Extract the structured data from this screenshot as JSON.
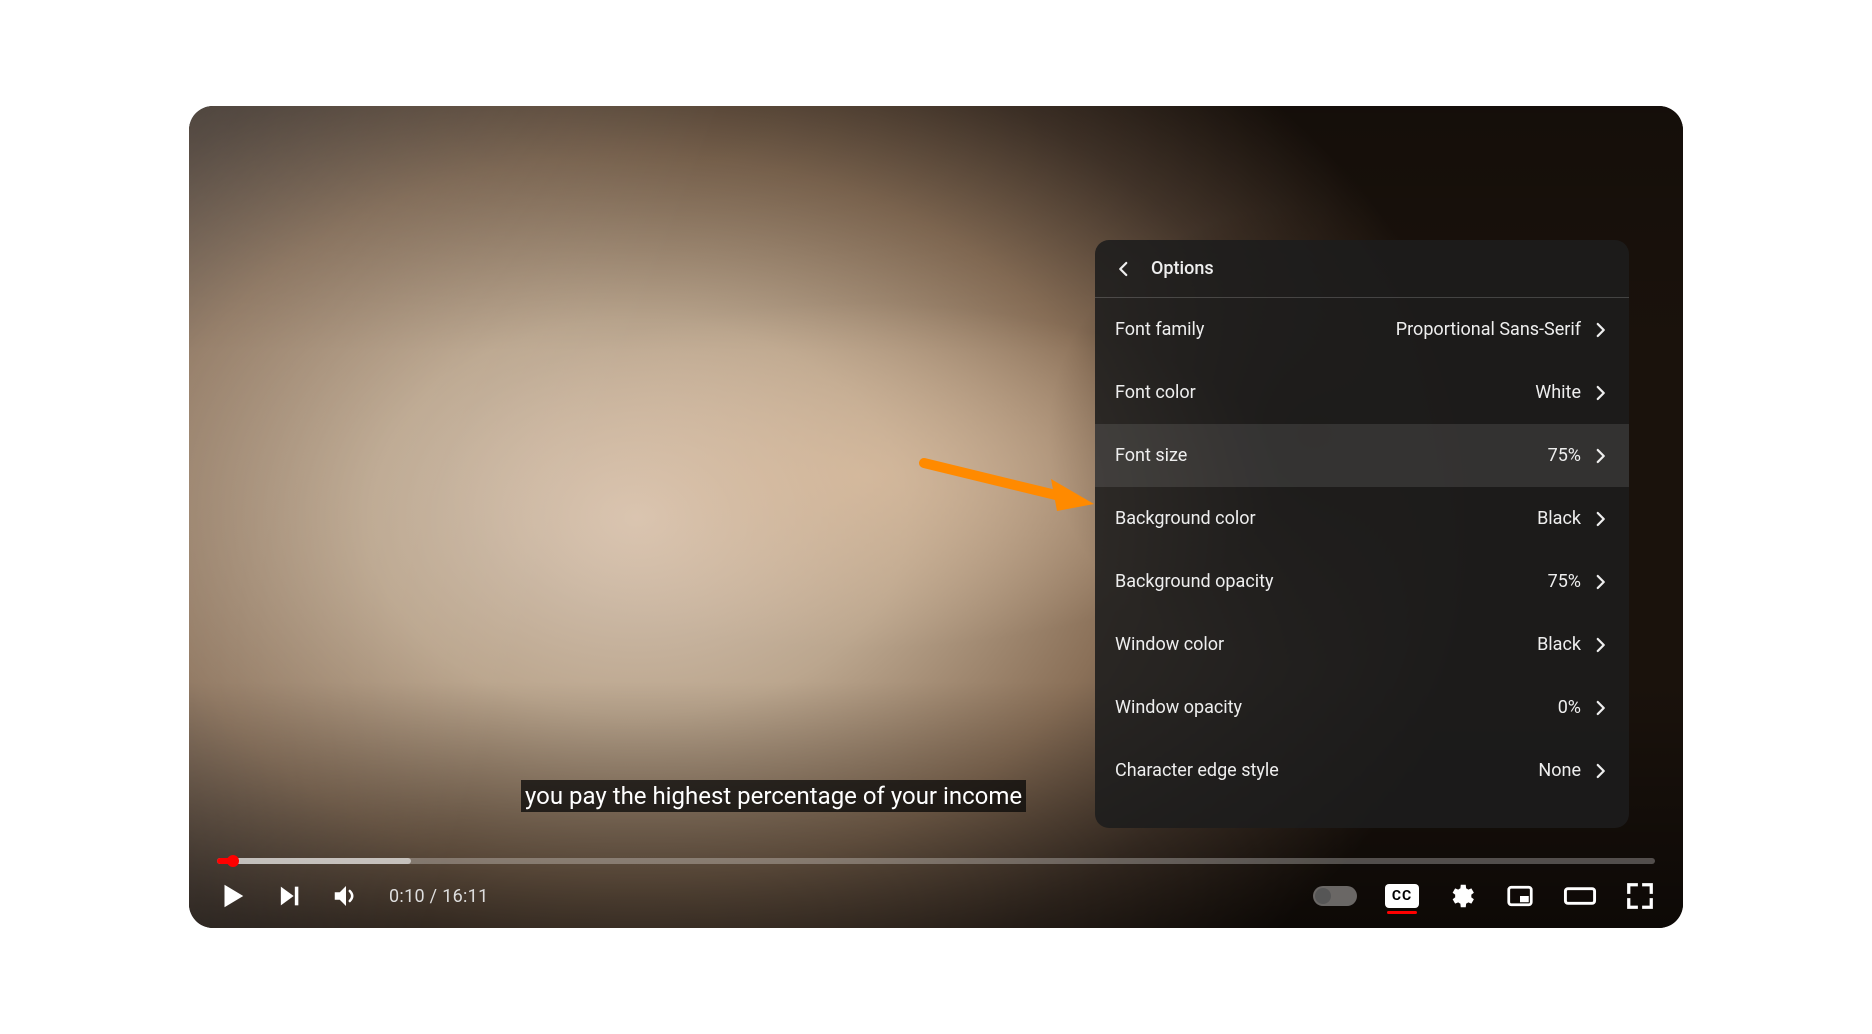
{
  "caption_text": "you pay the highest percentage of your income",
  "settings": {
    "title": "Options",
    "items": [
      {
        "label": "Font family",
        "value": "Proportional Sans-Serif",
        "hover": false
      },
      {
        "label": "Font color",
        "value": "White",
        "hover": false
      },
      {
        "label": "Font size",
        "value": "75%",
        "hover": true
      },
      {
        "label": "Background color",
        "value": "Black",
        "hover": false
      },
      {
        "label": "Background opacity",
        "value": "75%",
        "hover": false
      },
      {
        "label": "Window color",
        "value": "Black",
        "hover": false
      },
      {
        "label": "Window opacity",
        "value": "0%",
        "hover": false
      },
      {
        "label": "Character edge style",
        "value": "None",
        "hover": false
      }
    ]
  },
  "time": {
    "current": "0:10",
    "duration": "16:11",
    "sep": " / "
  },
  "cc_label": "CC"
}
